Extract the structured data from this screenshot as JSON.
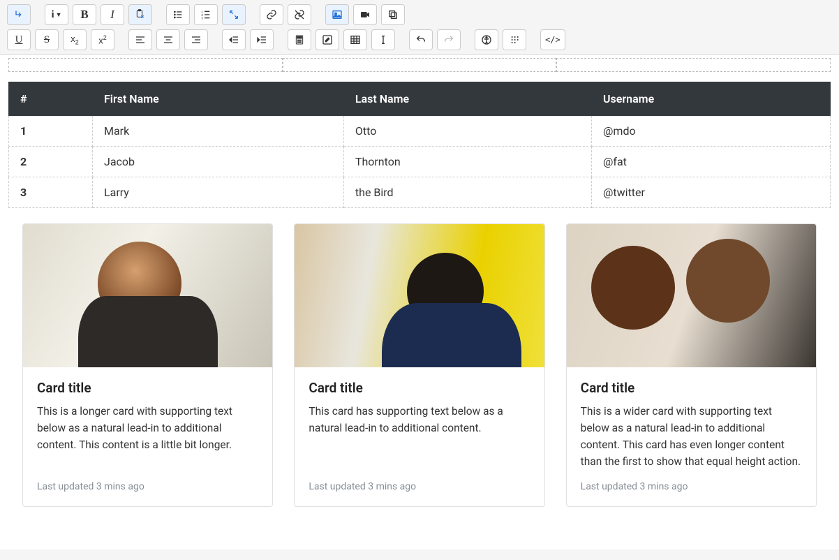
{
  "toolbar": {
    "row1": [
      {
        "name": "arrow-down-left-icon",
        "active": true
      },
      {
        "name": "info-dropdown-icon"
      },
      {
        "name": "bold-icon",
        "label": "B"
      },
      {
        "name": "italic-icon",
        "label": "I"
      },
      {
        "name": "paste-special-icon",
        "active": true
      },
      {
        "name": "unordered-list-icon"
      },
      {
        "name": "ordered-list-icon"
      },
      {
        "name": "expand-icon",
        "active": true
      },
      {
        "name": "link-icon"
      },
      {
        "name": "unlink-icon"
      },
      {
        "name": "image-icon",
        "active": true
      },
      {
        "name": "video-icon"
      },
      {
        "name": "copy-icon"
      }
    ],
    "row2": [
      {
        "name": "underline-icon",
        "label": "U"
      },
      {
        "name": "strikethrough-icon",
        "label": "S"
      },
      {
        "name": "subscript-icon",
        "label": "x₂"
      },
      {
        "name": "superscript-icon",
        "label": "x²"
      },
      {
        "name": "align-left-icon"
      },
      {
        "name": "align-center-icon"
      },
      {
        "name": "align-right-icon"
      },
      {
        "name": "outdent-icon"
      },
      {
        "name": "indent-icon"
      },
      {
        "name": "calculator-icon"
      },
      {
        "name": "edit-icon"
      },
      {
        "name": "table-icon"
      },
      {
        "name": "text-cursor-icon"
      },
      {
        "name": "undo-icon"
      },
      {
        "name": "redo-icon",
        "disabled": true
      },
      {
        "name": "accessibility-icon"
      },
      {
        "name": "braille-icon"
      },
      {
        "name": "code-view-icon",
        "label": "</>"
      }
    ]
  },
  "table": {
    "headers": [
      "#",
      "First Name",
      "Last Name",
      "Username"
    ],
    "rows": [
      {
        "idx": "1",
        "first": "Mark",
        "last": "Otto",
        "user": "@mdo"
      },
      {
        "idx": "2",
        "first": "Jacob",
        "last": "Thornton",
        "user": "@fat"
      },
      {
        "idx": "3",
        "first": "Larry",
        "last": "the Bird",
        "user": "@twitter"
      }
    ]
  },
  "cards": [
    {
      "title": "Card title",
      "text": "This is a longer card with supporting text below as a natural lead-in to additional content. This content is a little bit longer.",
      "meta": "Last updated 3 mins ago"
    },
    {
      "title": "Card title",
      "text": "This card has supporting text below as a natural lead-in to additional content.",
      "meta": "Last updated 3 mins ago"
    },
    {
      "title": "Card title",
      "text": "This is a wider card with supporting text below as a natural lead-in to additional content. This card has even longer content than the first to show that equal height action.",
      "meta": "Last updated 3 mins ago"
    }
  ]
}
